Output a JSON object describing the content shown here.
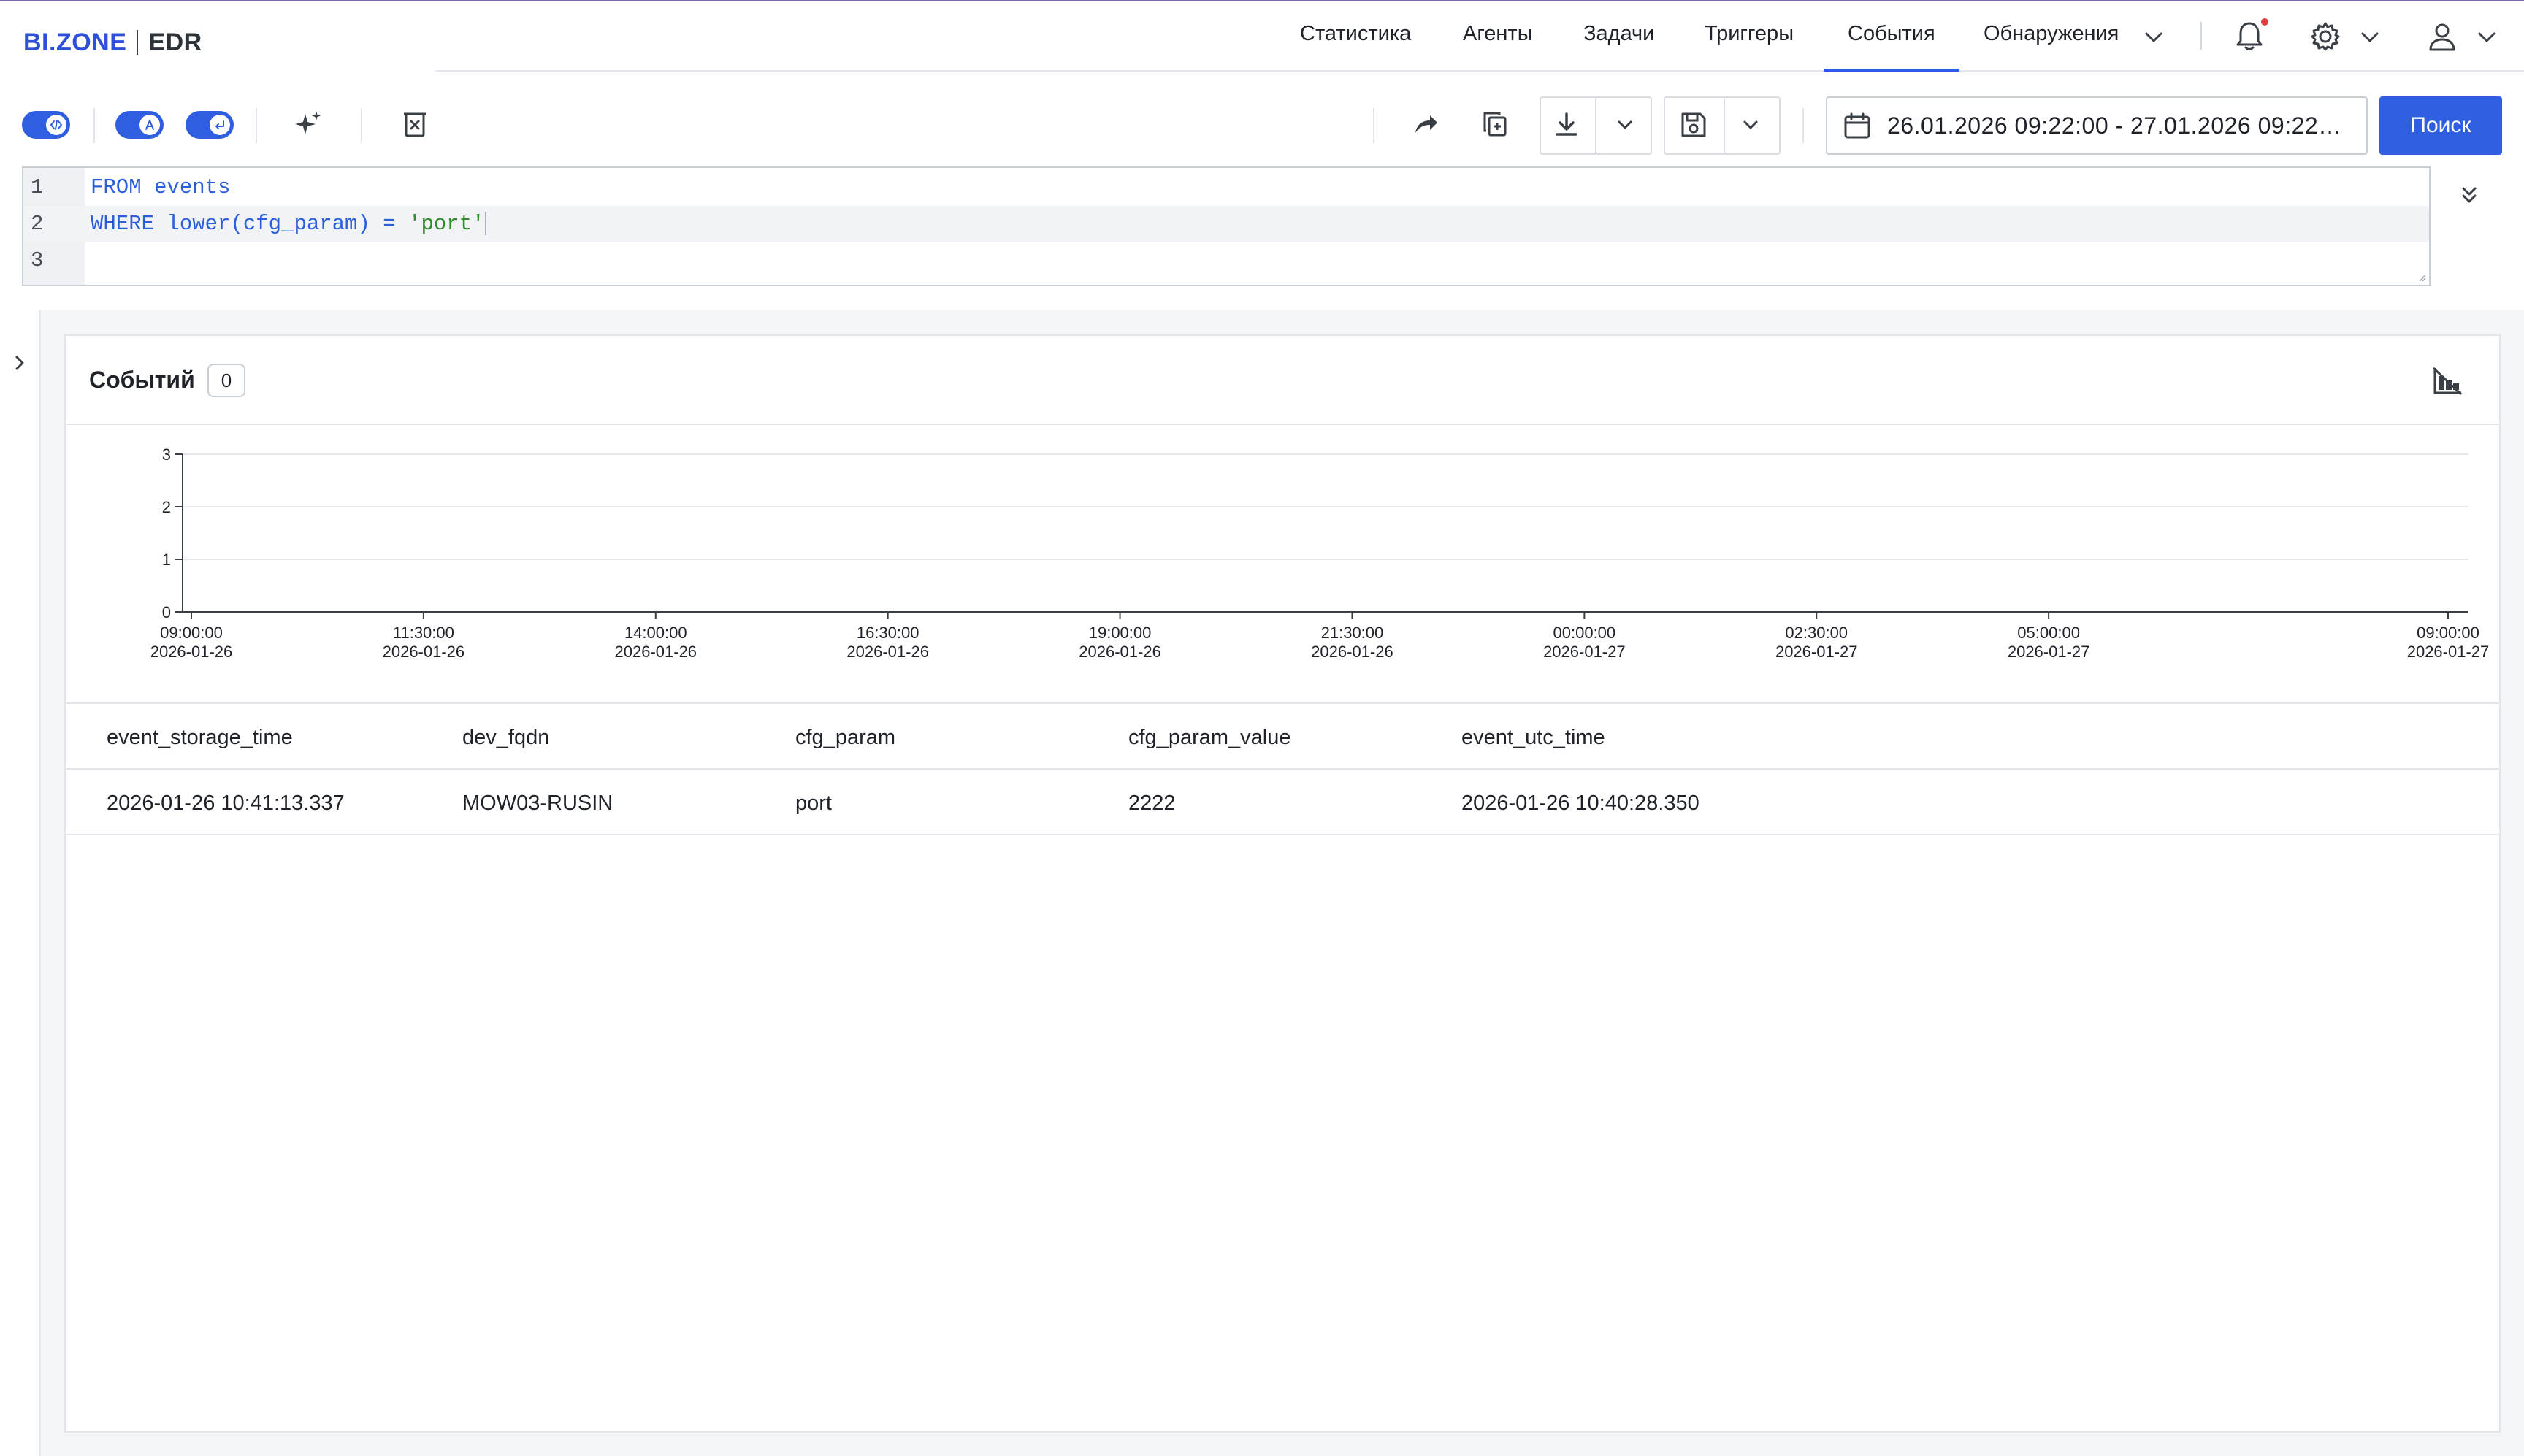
{
  "header": {
    "brand": "BI.ZONE",
    "product": "EDR",
    "nav": [
      {
        "label": "Статистика",
        "active": false
      },
      {
        "label": "Агенты",
        "active": false
      },
      {
        "label": "Задачи",
        "active": false
      },
      {
        "label": "Триггеры",
        "active": false
      },
      {
        "label": "События",
        "active": true
      },
      {
        "label": "Обнаружения",
        "active": false
      }
    ],
    "accent_color": "#3157e8",
    "notification_dot_color": "#e23b3b"
  },
  "toolbar": {
    "date_range": "26.01.2026 09:22:00 - 27.01.2026 09:22…",
    "search_label": "Поиск"
  },
  "editor": {
    "lines": [
      {
        "number": "1",
        "keyword": "FROM",
        "rest": " events",
        "string": ""
      },
      {
        "number": "2",
        "keyword": "WHERE",
        "rest": " lower(cfg_param) = ",
        "string": "'port'"
      },
      {
        "number": "3",
        "keyword": "",
        "rest": "",
        "string": ""
      }
    ]
  },
  "results": {
    "title": "Событий",
    "count": "0",
    "columns": [
      "event_storage_time",
      "dev_fqdn",
      "cfg_param",
      "cfg_param_value",
      "event_utc_time"
    ],
    "rows": [
      [
        "2026-01-26 10:41:13.337",
        "MOW03-RUSIN",
        "port",
        "2222",
        "2026-01-26 10:40:28.350"
      ]
    ]
  },
  "chart_data": {
    "type": "bar",
    "x_ticks": [
      {
        "time": "09:00:00",
        "date": "2026-01-26"
      },
      {
        "time": "11:30:00",
        "date": "2026-01-26"
      },
      {
        "time": "14:00:00",
        "date": "2026-01-26"
      },
      {
        "time": "16:30:00",
        "date": "2026-01-26"
      },
      {
        "time": "19:00:00",
        "date": "2026-01-26"
      },
      {
        "time": "21:30:00",
        "date": "2026-01-26"
      },
      {
        "time": "00:00:00",
        "date": "2026-01-27"
      },
      {
        "time": "02:30:00",
        "date": "2026-01-27"
      },
      {
        "time": "05:00:00",
        "date": "2026-01-27"
      },
      {
        "time": "09:00:00",
        "date": "2026-01-27"
      }
    ],
    "y_ticks": [
      "0",
      "1",
      "2",
      "3"
    ],
    "ylim": [
      0,
      3
    ],
    "values": [],
    "grid": true
  }
}
